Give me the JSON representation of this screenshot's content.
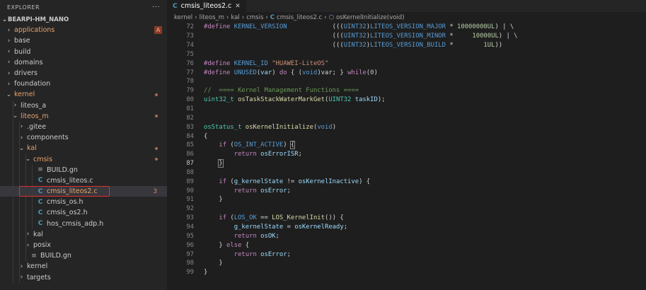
{
  "explorer": {
    "title": "EXPLORER",
    "more": "···",
    "project": "BEARPI-HM_NANO",
    "items": [
      {
        "label": "applications",
        "arrow": "›",
        "badge": "A",
        "color": "orange",
        "indent": 0
      },
      {
        "label": "base",
        "arrow": "›",
        "indent": 0
      },
      {
        "label": "build",
        "arrow": "›",
        "indent": 0
      },
      {
        "label": "domains",
        "arrow": "›",
        "indent": 0
      },
      {
        "label": "drivers",
        "arrow": "›",
        "indent": 0
      },
      {
        "label": "foundation",
        "arrow": "›",
        "indent": 0
      },
      {
        "label": "kernel",
        "arrow": "⌄",
        "dot": true,
        "color": "orange",
        "indent": 0
      },
      {
        "label": "liteos_a",
        "arrow": "›",
        "indent": 1
      },
      {
        "label": "liteos_m",
        "arrow": "⌄",
        "dot": true,
        "color": "orange",
        "indent": 1
      },
      {
        "label": ".gitee",
        "arrow": "›",
        "indent": 2
      },
      {
        "label": "components",
        "arrow": "›",
        "indent": 2
      },
      {
        "label": "kal",
        "arrow": "⌄",
        "dot": true,
        "color": "orange",
        "indent": 2
      },
      {
        "label": "cmsis",
        "arrow": "⌄",
        "dot": true,
        "color": "orange",
        "indent": 3
      },
      {
        "label": "BUILD.gn",
        "icon": "≡",
        "icon_type": "gn",
        "indent": 4
      },
      {
        "label": "cmsis_liteos.c",
        "icon": "C",
        "icon_type": "c",
        "indent": 4
      },
      {
        "label": "cmsis_liteos2.c",
        "icon": "C",
        "icon_type": "c",
        "selected": true,
        "num": "3",
        "color": "orange",
        "indent": 4
      },
      {
        "label": "cmsis_os.h",
        "icon": "C",
        "icon_type": "c",
        "indent": 4
      },
      {
        "label": "cmsis_os2.h",
        "icon": "C",
        "icon_type": "c",
        "indent": 4
      },
      {
        "label": "hos_cmsis_adp.h",
        "icon": "C",
        "icon_type": "c",
        "indent": 4
      },
      {
        "label": "kal",
        "arrow": "›",
        "indent": 3
      },
      {
        "label": "posix",
        "arrow": "›",
        "indent": 3
      },
      {
        "label": "BUILD.gn",
        "icon": "≡",
        "icon_type": "gn",
        "indent": 3
      },
      {
        "label": "kernel",
        "arrow": "›",
        "indent": 2
      },
      {
        "label": "targets",
        "arrow": "›",
        "indent": 2
      }
    ]
  },
  "tab": {
    "icon": "C",
    "label": "cmsis_liteos2.c",
    "close": "✕"
  },
  "breadcrumb": {
    "parts": [
      "kernel",
      "liteos_m",
      "kal",
      "cmsis"
    ],
    "sep": "›",
    "file_icon": "C",
    "file": "cmsis_liteos2.c",
    "symbol_icon": "⬡",
    "symbol": "osKernelInitialize(void)"
  },
  "code": {
    "current_line": 87,
    "lines": [
      {
        "n": "72",
        "guides": [],
        "tokens": [
          [
            "pp",
            "#define "
          ],
          [
            "mac",
            "KERNEL_VERSION"
          ],
          [
            "plain",
            "            ((("
          ],
          [
            "mac",
            "UINT32"
          ],
          [
            "plain",
            ")"
          ],
          [
            "mac",
            "LITEOS_VERSION_MAJOR"
          ],
          [
            "plain",
            " * "
          ],
          [
            "num",
            "10000000UL"
          ],
          [
            "plain",
            ") | \\"
          ]
        ]
      },
      {
        "n": "73",
        "tokens": [
          [
            "plain",
            "                                  ((("
          ],
          [
            "mac",
            "UINT32"
          ],
          [
            "plain",
            ")"
          ],
          [
            "mac",
            "LITEOS_VERSION_MINOR"
          ],
          [
            "plain",
            " *     "
          ],
          [
            "num",
            "10000UL"
          ],
          [
            "plain",
            ") | \\"
          ]
        ]
      },
      {
        "n": "74",
        "tokens": [
          [
            "plain",
            "                                  ((("
          ],
          [
            "mac",
            "UINT32"
          ],
          [
            "plain",
            ")"
          ],
          [
            "mac",
            "LITEOS_VERSION_BUILD"
          ],
          [
            "plain",
            " *        "
          ],
          [
            "num",
            "1UL"
          ],
          [
            "plain",
            "))"
          ]
        ]
      },
      {
        "n": "75",
        "tokens": []
      },
      {
        "n": "76",
        "tokens": [
          [
            "pp",
            "#define "
          ],
          [
            "mac",
            "KERNEL_ID"
          ],
          [
            "plain",
            " "
          ],
          [
            "str",
            "\"HUAWEI-LiteOS\""
          ]
        ]
      },
      {
        "n": "77",
        "tokens": [
          [
            "pp",
            "#define "
          ],
          [
            "mac",
            "UNUSED"
          ],
          [
            "plain",
            "("
          ],
          [
            "var",
            "var"
          ],
          [
            "plain",
            ") "
          ],
          [
            "kw",
            "do"
          ],
          [
            "plain",
            " { ("
          ],
          [
            "mac",
            "void"
          ],
          [
            "plain",
            ")var; } "
          ],
          [
            "kw",
            "while"
          ],
          [
            "plain",
            "("
          ],
          [
            "num",
            "0"
          ],
          [
            "plain",
            ")"
          ]
        ]
      },
      {
        "n": "78",
        "tokens": []
      },
      {
        "n": "79",
        "tokens": [
          [
            "com",
            "//  ==== Kernel Management Functions ===="
          ]
        ]
      },
      {
        "n": "80",
        "tokens": [
          [
            "type",
            "uint32_t"
          ],
          [
            "plain",
            " "
          ],
          [
            "fn",
            "osTaskStackWaterMarkGet"
          ],
          [
            "plain",
            "("
          ],
          [
            "type",
            "UINT32"
          ],
          [
            "plain",
            " "
          ],
          [
            "var",
            "taskID"
          ],
          [
            "plain",
            ");"
          ]
        ]
      },
      {
        "n": "81",
        "tokens": []
      },
      {
        "n": "82",
        "tokens": []
      },
      {
        "n": "83",
        "tokens": [
          [
            "type",
            "osStatus_t"
          ],
          [
            "plain",
            " "
          ],
          [
            "fn",
            "osKernelInitialize"
          ],
          [
            "plain",
            "("
          ],
          [
            "mac",
            "void"
          ],
          [
            "plain",
            ")"
          ]
        ]
      },
      {
        "n": "84",
        "tokens": [
          [
            "plain",
            "{"
          ]
        ]
      },
      {
        "n": "85",
        "tokens": [
          [
            "plain",
            "    "
          ],
          [
            "kw",
            "if"
          ],
          [
            "plain",
            " ("
          ],
          [
            "mac",
            "OS_INT_ACTIVE"
          ],
          [
            "plain",
            ") "
          ],
          [
            "box",
            "{"
          ]
        ]
      },
      {
        "n": "86",
        "tokens": [
          [
            "plain",
            "        "
          ],
          [
            "kw",
            "return"
          ],
          [
            "plain",
            " "
          ],
          [
            "var",
            "osErrorISR"
          ],
          [
            "plain",
            ";"
          ]
        ]
      },
      {
        "n": "87",
        "tokens": [
          [
            "plain",
            "    "
          ],
          [
            "box",
            "}"
          ]
        ]
      },
      {
        "n": "88",
        "tokens": []
      },
      {
        "n": "89",
        "tokens": [
          [
            "plain",
            "    "
          ],
          [
            "kw",
            "if"
          ],
          [
            "plain",
            " ("
          ],
          [
            "var",
            "g_kernelState"
          ],
          [
            "plain",
            " != "
          ],
          [
            "var",
            "osKernelInactive"
          ],
          [
            "plain",
            ") {"
          ]
        ]
      },
      {
        "n": "90",
        "tokens": [
          [
            "plain",
            "        "
          ],
          [
            "kw",
            "return"
          ],
          [
            "plain",
            " "
          ],
          [
            "var",
            "osError"
          ],
          [
            "plain",
            ";"
          ]
        ]
      },
      {
        "n": "91",
        "tokens": [
          [
            "plain",
            "    }"
          ]
        ]
      },
      {
        "n": "92",
        "tokens": []
      },
      {
        "n": "93",
        "tokens": [
          [
            "plain",
            "    "
          ],
          [
            "kw",
            "if"
          ],
          [
            "plain",
            " ("
          ],
          [
            "mac",
            "LOS_OK"
          ],
          [
            "plain",
            " == "
          ],
          [
            "fn",
            "LOS_KernelInit"
          ],
          [
            "plain",
            "()) {"
          ]
        ]
      },
      {
        "n": "94",
        "tokens": [
          [
            "plain",
            "        "
          ],
          [
            "var",
            "g_kernelState"
          ],
          [
            "plain",
            " = "
          ],
          [
            "var",
            "osKernelReady"
          ],
          [
            "plain",
            ";"
          ]
        ]
      },
      {
        "n": "95",
        "tokens": [
          [
            "plain",
            "        "
          ],
          [
            "kw",
            "return"
          ],
          [
            "plain",
            " "
          ],
          [
            "var",
            "osOK"
          ],
          [
            "plain",
            ";"
          ]
        ]
      },
      {
        "n": "96",
        "tokens": [
          [
            "plain",
            "    } "
          ],
          [
            "kw",
            "else"
          ],
          [
            "plain",
            " {"
          ]
        ]
      },
      {
        "n": "97",
        "tokens": [
          [
            "plain",
            "        "
          ],
          [
            "kw",
            "return"
          ],
          [
            "plain",
            " "
          ],
          [
            "var",
            "osError"
          ],
          [
            "plain",
            ";"
          ]
        ]
      },
      {
        "n": "98",
        "tokens": [
          [
            "plain",
            "    }"
          ]
        ]
      },
      {
        "n": "99",
        "tokens": [
          [
            "plain",
            "}"
          ]
        ]
      }
    ]
  }
}
